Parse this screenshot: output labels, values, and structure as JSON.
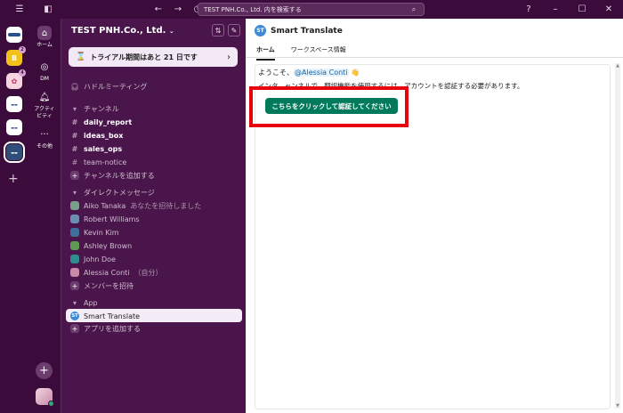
{
  "titlebar": {
    "search_text": "TEST PNH.Co., Ltd. 内を検索する"
  },
  "rail": {
    "workspaces": [
      {
        "badge": ""
      },
      {
        "badge": "2"
      },
      {
        "badge": "4"
      },
      {
        "badge": ""
      },
      {
        "badge": ""
      },
      {
        "badge": ""
      }
    ]
  },
  "nav": {
    "home": "ホーム",
    "dm": "DM",
    "activity_line1": "アクティ",
    "activity_line2": "ビティ",
    "more": "その他"
  },
  "sidebar": {
    "workspace_name": "TEST PNH.Co., Ltd.",
    "trial_label": "トライアル期間はあと 21 日です",
    "huddle": "ハドルミーティング",
    "channels_header": "チャンネル",
    "channels": [
      {
        "name": "daily_report",
        "bold": true
      },
      {
        "name": "ideas_box",
        "bold": true
      },
      {
        "name": "sales_ops",
        "bold": true
      },
      {
        "name": "team-notice",
        "bold": false
      }
    ],
    "add_channel": "チャンネルを追加する",
    "dm_header": "ダイレクトメッセージ",
    "dms": [
      {
        "name": "Aiko Tanaka",
        "note": "あなたを招待しました",
        "color": "#7a9e8a"
      },
      {
        "name": "Robert Williams",
        "note": "",
        "color": "#6b8fb0"
      },
      {
        "name": "Kevin Kim",
        "note": "",
        "color": "#3d6f9a"
      },
      {
        "name": "Ashley Brown",
        "note": "",
        "color": "#5f9a54"
      },
      {
        "name": "John Doe",
        "note": "",
        "color": "#2f8c8c"
      },
      {
        "name": "Alessia Conti",
        "note": "（自分）",
        "color": "#c98aa8"
      }
    ],
    "invite_members": "メンバーを招待",
    "app_header": "App",
    "apps": [
      {
        "name": "Smart Translate"
      }
    ],
    "add_app": "アプリを追加する"
  },
  "main": {
    "app_logo": "ST",
    "app_title": "Smart Translate",
    "tabs": [
      {
        "label": "ホーム"
      },
      {
        "label": "ワークスペース情報"
      }
    ],
    "welcome_prefix": "ようこそ、",
    "welcome_mention": "@Alessia Conti",
    "welcome_emoji": "👋",
    "description": "インタ...ャンネルで...翻訳機能を使用するには、アカウントを認証する必要があります。",
    "auth_button": "こちらをクリックして認証してください"
  },
  "colors": {
    "accent_button": "#007a5a",
    "highlight": "#e8000c",
    "sidebar_bg": "#4a154b"
  }
}
